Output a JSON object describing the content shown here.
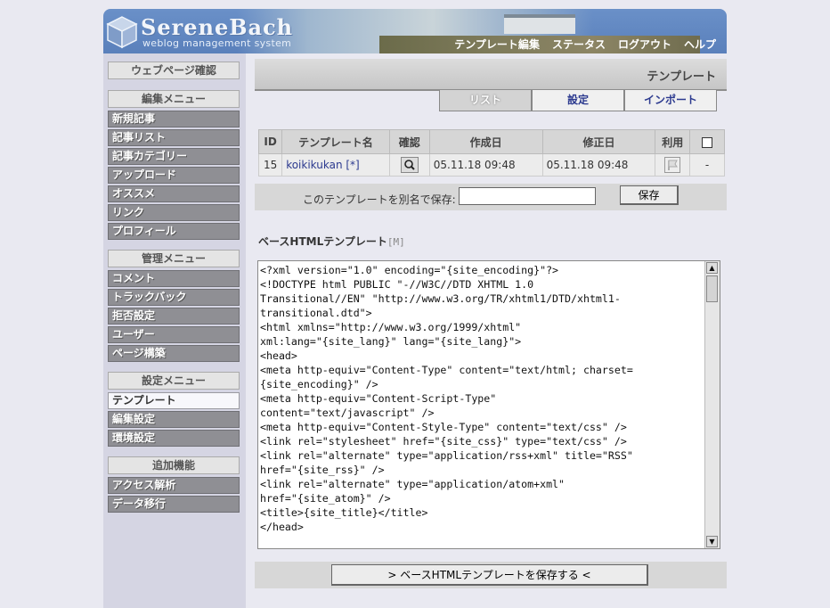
{
  "brand": {
    "name": "SereneBach",
    "tagline": "weblog management system"
  },
  "topnav": [
    "テンプレート編集",
    "ステータス",
    "ログアウト",
    "ヘルプ"
  ],
  "sidebar": {
    "webpage_check": "ウェブページ確認",
    "edit_menu": {
      "heading": "編集メニュー",
      "items": [
        "新規記事",
        "記事リスト",
        "記事カテゴリー",
        "アップロード",
        "オススメ",
        "リンク",
        "プロフィール"
      ]
    },
    "admin_menu": {
      "heading": "管理メニュー",
      "items": [
        "コメント",
        "トラックバック",
        "拒否設定",
        "ユーザー",
        "ページ構築"
      ]
    },
    "settings_menu": {
      "heading": "設定メニュー",
      "items": [
        "テンプレート",
        "編集設定",
        "環境設定"
      ]
    },
    "extra_menu": {
      "heading": "追加機能",
      "items": [
        "アクセス解析",
        "データ移行"
      ]
    }
  },
  "main": {
    "title": "テンプレート",
    "tabs": [
      "リスト",
      "設定",
      "インポート"
    ],
    "table": {
      "headers": [
        "ID",
        "テンプレート名",
        "確認",
        "作成日",
        "修正日",
        "利用"
      ],
      "rows": [
        {
          "id": "15",
          "name": "koikikukan [*]",
          "created": "05.11.18 09:48",
          "modified": "05.11.18 09:48",
          "last": "-"
        }
      ]
    },
    "saveas": {
      "label": "このテンプレートを別名で保存:",
      "value": "",
      "button": "保存"
    },
    "base_template": {
      "label": "ベースHTMLテンプレート",
      "marker": "[M]",
      "code": "<?xml version=\"1.0\" encoding=\"{site_encoding}\"?>\n<!DOCTYPE html PUBLIC \"-//W3C//DTD XHTML 1.0\nTransitional//EN\" \"http://www.w3.org/TR/xhtml1/DTD/xhtml1-\ntransitional.dtd\">\n<html xmlns=\"http://www.w3.org/1999/xhtml\"\nxml:lang=\"{site_lang}\" lang=\"{site_lang}\">\n<head>\n<meta http-equiv=\"Content-Type\" content=\"text/html; charset=\n{site_encoding}\" />\n<meta http-equiv=\"Content-Script-Type\"\ncontent=\"text/javascript\" />\n<meta http-equiv=\"Content-Style-Type\" content=\"text/css\" />\n<link rel=\"stylesheet\" href=\"{site_css}\" type=\"text/css\" />\n<link rel=\"alternate\" type=\"application/rss+xml\" title=\"RSS\"\nhref=\"{site_rss}\" />\n<link rel=\"alternate\" type=\"application/atom+xml\"\nhref=\"{site_atom}\" />\n<title>{site_title}</title>\n</head>",
      "save_button": "> ベースHTMLテンプレートを保存する <"
    }
  }
}
